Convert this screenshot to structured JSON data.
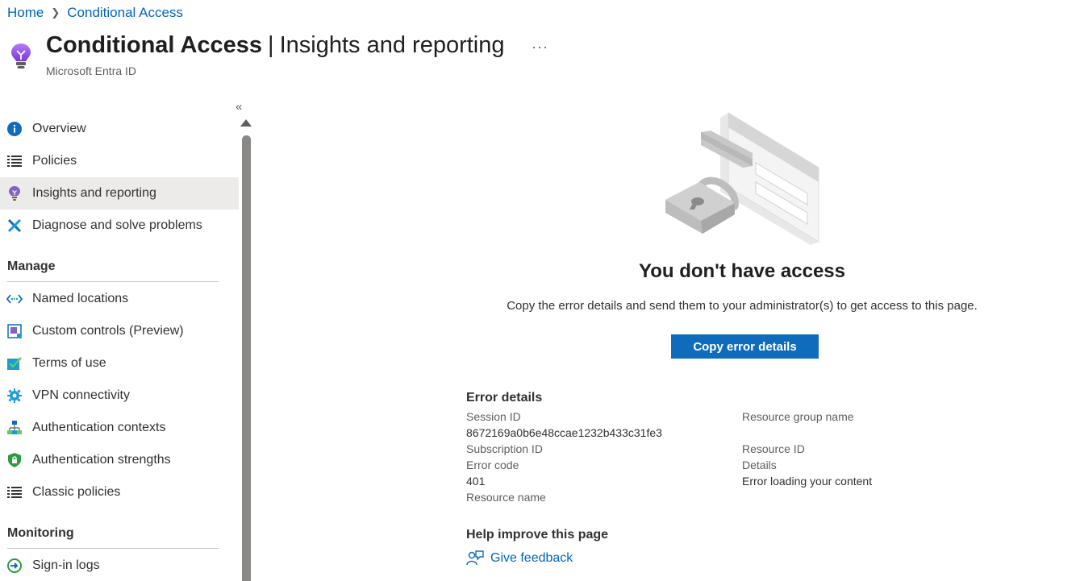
{
  "breadcrumb": {
    "home": "Home",
    "current": "Conditional Access"
  },
  "header": {
    "title_bold": "Conditional Access",
    "separator": "|",
    "title_rest": "Insights and reporting",
    "subtitle": "Microsoft Entra ID",
    "more": "···"
  },
  "sidebar": {
    "collapse": "«",
    "items": [
      {
        "label": "Overview",
        "icon": "info-icon"
      },
      {
        "label": "Policies",
        "icon": "list-icon"
      },
      {
        "label": "Insights and reporting",
        "icon": "lightbulb-icon",
        "active": true
      },
      {
        "label": "Diagnose and solve problems",
        "icon": "wrench-icon"
      }
    ],
    "manage_header": "Manage",
    "manage_items": [
      {
        "label": "Named locations",
        "icon": "location-icon"
      },
      {
        "label": "Custom controls (Preview)",
        "icon": "custom-controls-icon"
      },
      {
        "label": "Terms of use",
        "icon": "checkmark-icon"
      },
      {
        "label": "VPN connectivity",
        "icon": "gear-icon"
      },
      {
        "label": "Authentication contexts",
        "icon": "hierarchy-icon"
      },
      {
        "label": "Authentication strengths",
        "icon": "shield-lock-icon"
      },
      {
        "label": "Classic policies",
        "icon": "list-icon"
      }
    ],
    "monitoring_header": "Monitoring",
    "monitoring_items": [
      {
        "label": "Sign-in logs",
        "icon": "sign-in-icon"
      }
    ]
  },
  "main": {
    "heading": "You don't have access",
    "description": "Copy the error details and send them to your administrator(s) to get access to this page.",
    "copy_button": "Copy error details",
    "error_title": "Error details",
    "left": {
      "session_id_label": "Session ID",
      "session_id_value": "8672169a0b6e48ccae1232b433c31fe3",
      "subscription_id_label": "Subscription ID",
      "error_code_label": "Error code",
      "error_code_value": "401",
      "resource_name_label": "Resource name"
    },
    "right": {
      "resource_group_label": "Resource group name",
      "resource_id_label": "Resource ID",
      "details_label": "Details",
      "details_value": "Error loading your content"
    },
    "help_title": "Help improve this page",
    "feedback": "Give feedback"
  },
  "colors": {
    "accent": "#0f6cbd",
    "link": "#0064bf",
    "active_bg": "#edebe9",
    "purple": "#8661c5"
  }
}
